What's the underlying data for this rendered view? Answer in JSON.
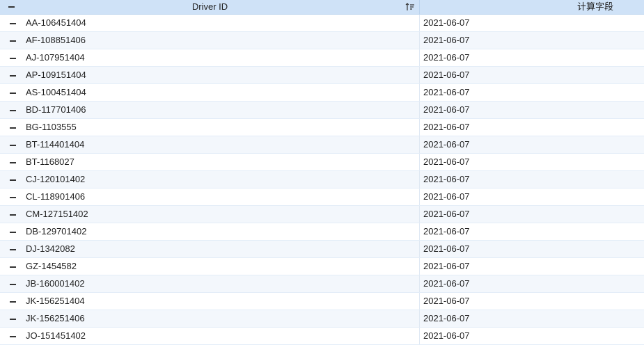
{
  "header": {
    "driver_id_label": "Driver ID",
    "calc_field_label": "计算字段"
  },
  "rows": [
    {
      "driver_id": "AA-106451404",
      "calc": "2021-06-07"
    },
    {
      "driver_id": "AF-108851406",
      "calc": "2021-06-07"
    },
    {
      "driver_id": "AJ-107951404",
      "calc": "2021-06-07"
    },
    {
      "driver_id": "AP-109151404",
      "calc": "2021-06-07"
    },
    {
      "driver_id": "AS-100451404",
      "calc": "2021-06-07"
    },
    {
      "driver_id": "BD-117701406",
      "calc": "2021-06-07"
    },
    {
      "driver_id": "BG-1103555",
      "calc": "2021-06-07"
    },
    {
      "driver_id": "BT-114401404",
      "calc": "2021-06-07"
    },
    {
      "driver_id": "BT-1168027",
      "calc": "2021-06-07"
    },
    {
      "driver_id": "CJ-120101402",
      "calc": "2021-06-07"
    },
    {
      "driver_id": "CL-118901406",
      "calc": "2021-06-07"
    },
    {
      "driver_id": "CM-127151402",
      "calc": "2021-06-07"
    },
    {
      "driver_id": "DB-129701402",
      "calc": "2021-06-07"
    },
    {
      "driver_id": "DJ-1342082",
      "calc": "2021-06-07"
    },
    {
      "driver_id": "GZ-1454582",
      "calc": "2021-06-07"
    },
    {
      "driver_id": "JB-160001402",
      "calc": "2021-06-07"
    },
    {
      "driver_id": "JK-156251404",
      "calc": "2021-06-07"
    },
    {
      "driver_id": "JK-156251406",
      "calc": "2021-06-07"
    },
    {
      "driver_id": "JO-151451402",
      "calc": "2021-06-07"
    }
  ]
}
